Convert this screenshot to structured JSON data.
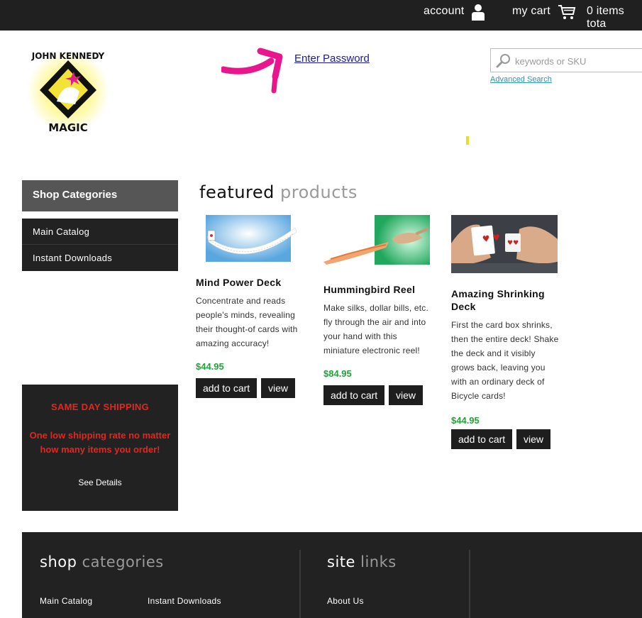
{
  "topbar": {
    "account_label": "account",
    "cart_label": "my cart",
    "cart_total": "0 items tota"
  },
  "header": {
    "logo_line1": "JOHN KENNEDY",
    "logo_line2": "MAGIC",
    "enter_password": "Enter Password",
    "search_placeholder": "keywords or SKU",
    "advanced_search": "Advanced Search"
  },
  "sidebar": {
    "heading": "Shop Categories",
    "items": [
      {
        "label": "Main Catalog"
      },
      {
        "label": "Instant Downloads"
      }
    ],
    "shipping": {
      "title": "SAME DAY SHIPPING",
      "text_line1": "One low shipping rate no matter",
      "text_line2": "how many items you order!",
      "link": "See Details"
    }
  },
  "featured": {
    "heading_a": "featured",
    "heading_b": "products",
    "products": [
      {
        "name": "Mind Power Deck",
        "desc": [
          "Concentrate and reads",
          "people's minds, revealing",
          "their thought-of cards with",
          "amazing accuracy!"
        ],
        "price": "$44.95",
        "add_label": "add to cart",
        "view_label": "view"
      },
      {
        "name": "Hummingbird Reel",
        "desc": [
          "Make silks, dollar bills, etc.",
          "fly through the air and into",
          "your hand with this",
          "miniature electronic reel!"
        ],
        "price": "$84.95",
        "add_label": "add to cart",
        "view_label": "view"
      },
      {
        "name_line1": "Amazing Shrinking",
        "name_line2": "Deck",
        "desc": [
          "First the card box shrinks,",
          "then the entire deck! Shake",
          "the deck and it visibly",
          "grows back, leaving you",
          "with an ordinary deck of",
          "Bicycle cards!"
        ],
        "price": "$44.95",
        "add_label": "add to cart",
        "view_label": "view"
      }
    ]
  },
  "footer": {
    "shop_a": "shop",
    "shop_b": "categories",
    "site_a": "site",
    "site_b": "links",
    "links": [
      "Main Catalog",
      "Instant Downloads",
      "About Us"
    ]
  },
  "colors": {
    "dark": "#202020",
    "price_green": "#22a33a",
    "shipping_red": "#e5261f",
    "arrow_pink": "#e8168c",
    "link_blue": "#1a1aa6"
  }
}
